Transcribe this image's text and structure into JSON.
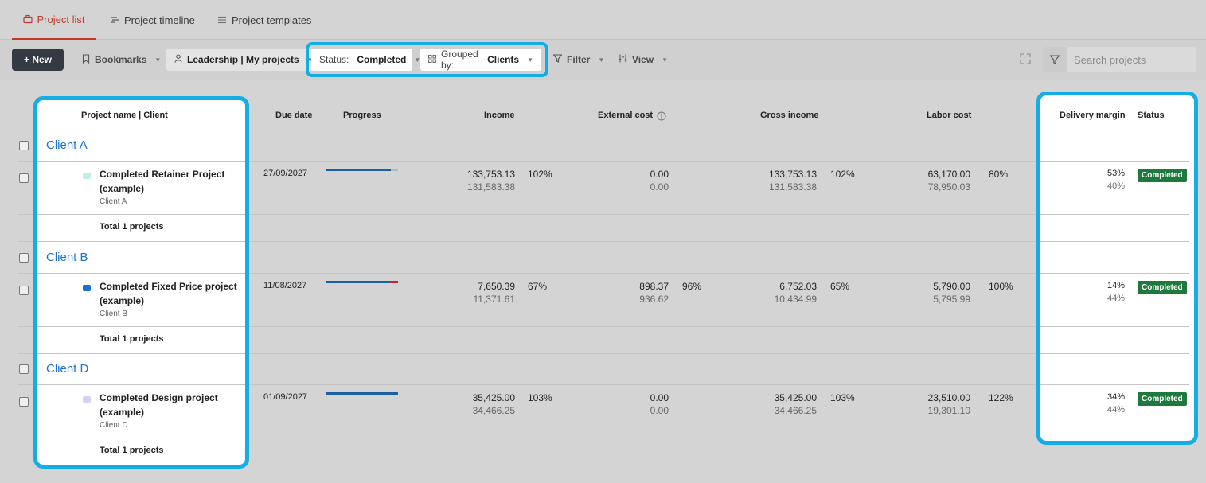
{
  "tabs": [
    {
      "label": "Project list",
      "active": true,
      "icon": "briefcase-icon"
    },
    {
      "label": "Project timeline",
      "active": false,
      "icon": "timeline-icon"
    },
    {
      "label": "Project templates",
      "active": false,
      "icon": "list-icon"
    }
  ],
  "toolbar": {
    "new_label": "+ New",
    "bookmarks_label": "Bookmarks",
    "leadership_label": "Leadership | My projects",
    "status_prefix": "Status:",
    "status_value": "Completed",
    "grouped_prefix": "Grouped by:",
    "grouped_value": "Clients",
    "filter_label": "Filter",
    "view_label": "View",
    "search_placeholder": "Search projects"
  },
  "columns": {
    "project_name": "Project name | Client",
    "due_date": "Due date",
    "progress": "Progress",
    "income": "Income",
    "external_cost": "External cost",
    "gross_income": "Gross income",
    "labor_cost": "Labor cost",
    "delivery_margin": "Delivery margin",
    "status": "Status"
  },
  "groups": [
    {
      "client": "Client A",
      "project": {
        "name_line1": "Completed Retainer Project",
        "name_line2": "(example)",
        "client": "Client A",
        "icon_color": "#bfeee9",
        "due_date": "27/09/2027",
        "progress": 0.9,
        "progress_over": 0,
        "income": "133,753.13",
        "income_sub": "131,583.38",
        "income_pct": "102%",
        "ext_cost": "0.00",
        "ext_cost_sub": "0.00",
        "ext_cost_pct": "",
        "gross": "133,753.13",
        "gross_sub": "131,583.38",
        "gross_pct": "102%",
        "labor": "63,170.00",
        "labor_sub": "78,950.03",
        "labor_pct": "80%",
        "margin": "53%",
        "margin_sub": "40%",
        "status": "Completed"
      },
      "total": "Total 1 projects"
    },
    {
      "client": "Client B",
      "project": {
        "name_line1": "Completed Fixed Price project",
        "name_line2": "(example)",
        "client": "Client B",
        "icon_color": "#1b6fd0",
        "due_date": "11/08/2027",
        "progress": 0.88,
        "progress_over": 0.12,
        "income": "7,650.39",
        "income_sub": "11,371.61",
        "income_pct": "67%",
        "ext_cost": "898.37",
        "ext_cost_sub": "936.62",
        "ext_cost_pct": "96%",
        "gross": "6,752.03",
        "gross_sub": "10,434.99",
        "gross_pct": "65%",
        "labor": "5,790.00",
        "labor_sub": "5,795.99",
        "labor_pct": "100%",
        "margin": "14%",
        "margin_sub": "44%",
        "status": "Completed"
      },
      "total": "Total 1 projects"
    },
    {
      "client": "Client D",
      "project": {
        "name_line1": "Completed Design project",
        "name_line2": "(example)",
        "client": "Client D",
        "icon_color": "#d9cdf3",
        "due_date": "01/09/2027",
        "progress": 1.0,
        "progress_over": 0,
        "income": "35,425.00",
        "income_sub": "34,466.25",
        "income_pct": "103%",
        "ext_cost": "0.00",
        "ext_cost_sub": "0.00",
        "ext_cost_pct": "",
        "gross": "35,425.00",
        "gross_sub": "34,466.25",
        "gross_pct": "103%",
        "labor": "23,510.00",
        "labor_sub": "19,301.10",
        "labor_pct": "122%",
        "margin": "34%",
        "margin_sub": "44%",
        "status": "Completed"
      },
      "total": "Total 1 projects"
    }
  ],
  "colors": {
    "accent_red": "#c0392b",
    "link_blue": "#1a73c9",
    "highlight": "#13aee6",
    "status_green": "#1e7a3c",
    "progress_blue": "#1b5fa6",
    "progress_over": "#c0282d"
  }
}
